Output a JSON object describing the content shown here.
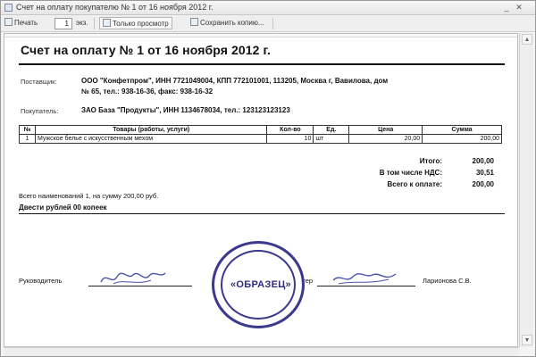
{
  "window": {
    "title": "Счет на оплату покупателю № 1 от 16 ноября 2012 г."
  },
  "toolbar": {
    "print_label": "Печать",
    "copies_value": "1",
    "copies_unit": "экз.",
    "preview_label": "Только просмотр",
    "save_label": "Сохранить копию..."
  },
  "document": {
    "title": "Счет на оплату № 1 от 16 ноября 2012 г.",
    "supplier_label": "Поставщик:",
    "supplier_line1": "ООО \"Конфетпром\", ИНН 7721049004, КПП 772101001, 113205, Москва г, Вавилова, дом",
    "supplier_line2": "№ 65, тел.: 938-16-36, факс: 938-16-32",
    "buyer_label": "Покупатель:",
    "buyer_value": "ЗАО База \"Продукты\", ИНН 1134678034, тел.: 123123123123"
  },
  "table": {
    "headers": [
      "№",
      "Товары (работы, услуги)",
      "Кол-во",
      "Ед.",
      "Цена",
      "Сумма"
    ],
    "rows": [
      {
        "num": "1",
        "name": "Мужское белье с искусственным мехом",
        "qty": "10",
        "unit": "шт",
        "price": "20,00",
        "sum": "200,00"
      }
    ]
  },
  "totals": {
    "total_label": "Итого:",
    "total_value": "200,00",
    "vat_label": "В том числе НДС:",
    "vat_value": "30,51",
    "due_label": "Всего к оплате:",
    "due_value": "200,00"
  },
  "summary": {
    "count_text": "Всего наименований 1, на сумму 200,00 руб.",
    "words_text": "Двести рублей 00 копеек"
  },
  "signatures": {
    "head_label": "Руководитель",
    "accountant_label": "Бухгалтер",
    "accountant_name": "Ларионова С.В."
  },
  "stamp": {
    "text": "«ОБРАЗЕЦ»"
  },
  "colors": {
    "stamp": "#3b3a8c",
    "signature_ink": "#4a55a8"
  }
}
